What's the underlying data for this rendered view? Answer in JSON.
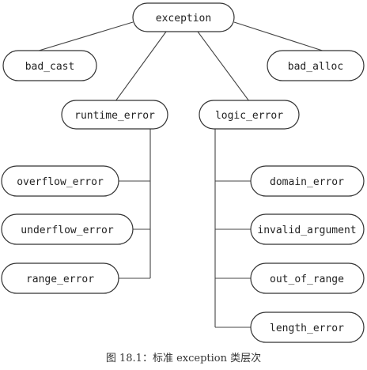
{
  "nodes": {
    "exception": "exception",
    "bad_cast": "bad_cast",
    "bad_alloc": "bad_alloc",
    "runtime_error": "runtime_error",
    "logic_error": "logic_error",
    "overflow_error": "overflow_error",
    "underflow_error": "underflow_error",
    "range_error": "range_error",
    "domain_error": "domain_error",
    "invalid_argument": "invalid_argument",
    "out_of_range": "out_of_range",
    "length_error": "length_error"
  },
  "caption": "图 18.1：标准 exception 类层次"
}
